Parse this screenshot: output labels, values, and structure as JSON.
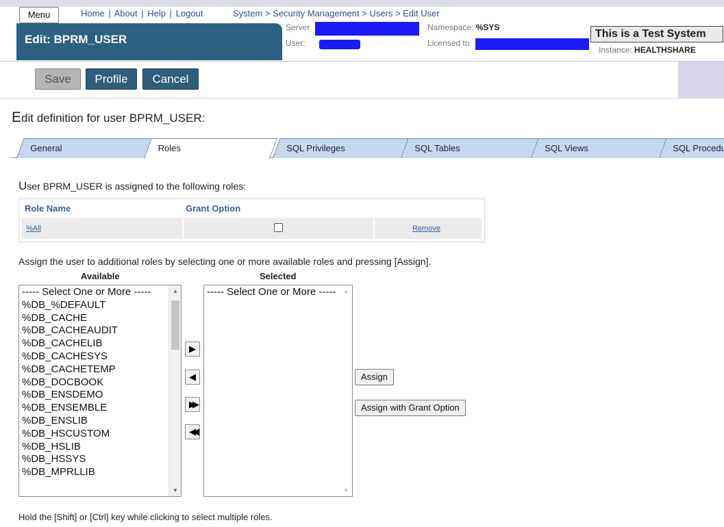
{
  "header": {
    "menu_label": "Menu",
    "links": [
      "Home",
      "About",
      "Help",
      "Logout"
    ],
    "link_sep": "|",
    "breadcrumb": "System > Security Management > Users > Edit User",
    "page_title": "Edit: BPRM_USER",
    "server_label": "Server",
    "user_label": "User:",
    "namespace_label": "Namespace:",
    "namespace_value": "%SYS",
    "licensed_label": "Licensed to",
    "test_system": "This is a Test System",
    "instance_label": "Instance:",
    "instance_value": "HEALTHSHARE",
    "redact_color": "#1a1aff"
  },
  "toolbar": {
    "save_label": "Save",
    "profile_label": "Profile",
    "cancel_label": "Cancel"
  },
  "page": {
    "heading_first": "E",
    "heading_rest": "dit definition for user BPRM_USER:"
  },
  "tabs": [
    {
      "label": "General"
    },
    {
      "label": "Roles",
      "active": true
    },
    {
      "label": "SQL Privileges"
    },
    {
      "label": "SQL Tables"
    },
    {
      "label": "SQL Views"
    },
    {
      "label": "SQL Procedu"
    }
  ],
  "roles": {
    "intro_first": "U",
    "intro_rest": "ser BPRM_USER is assigned to the following roles:",
    "col_role": "Role Name",
    "col_grant": "Grant Option",
    "rows": [
      {
        "role": "%All",
        "grant": false,
        "action": "Remove"
      }
    ]
  },
  "assign": {
    "instruction": "Assign the user to additional roles by selecting one or more available roles and pressing [Assign].",
    "available_label": "Available",
    "selected_label": "Selected",
    "available": [
      "----- Select One or More -----",
      "%DB_%DEFAULT",
      "%DB_CACHE",
      "%DB_CACHEAUDIT",
      "%DB_CACHELIB",
      "%DB_CACHESYS",
      "%DB_CACHETEMP",
      "%DB_DOCBOOK",
      "%DB_ENSDEMO",
      "%DB_ENSEMBLE",
      "%DB_ENSLIB",
      "%DB_HSCUSTOM",
      "%DB_HSLIB",
      "%DB_HSSYS",
      "%DB_MPRLLIB"
    ],
    "selected": [
      "----- Select One or More -----"
    ],
    "assign_label": "Assign",
    "assign_grant_label": "Assign with Grant Option",
    "move_buttons": [
      "arrow-right-icon",
      "arrow-left-icon",
      "double-arrow-right-icon",
      "double-arrow-left-icon"
    ],
    "hint": "Hold the [Shift] or [Ctrl] key while clicking to select multiple roles."
  }
}
